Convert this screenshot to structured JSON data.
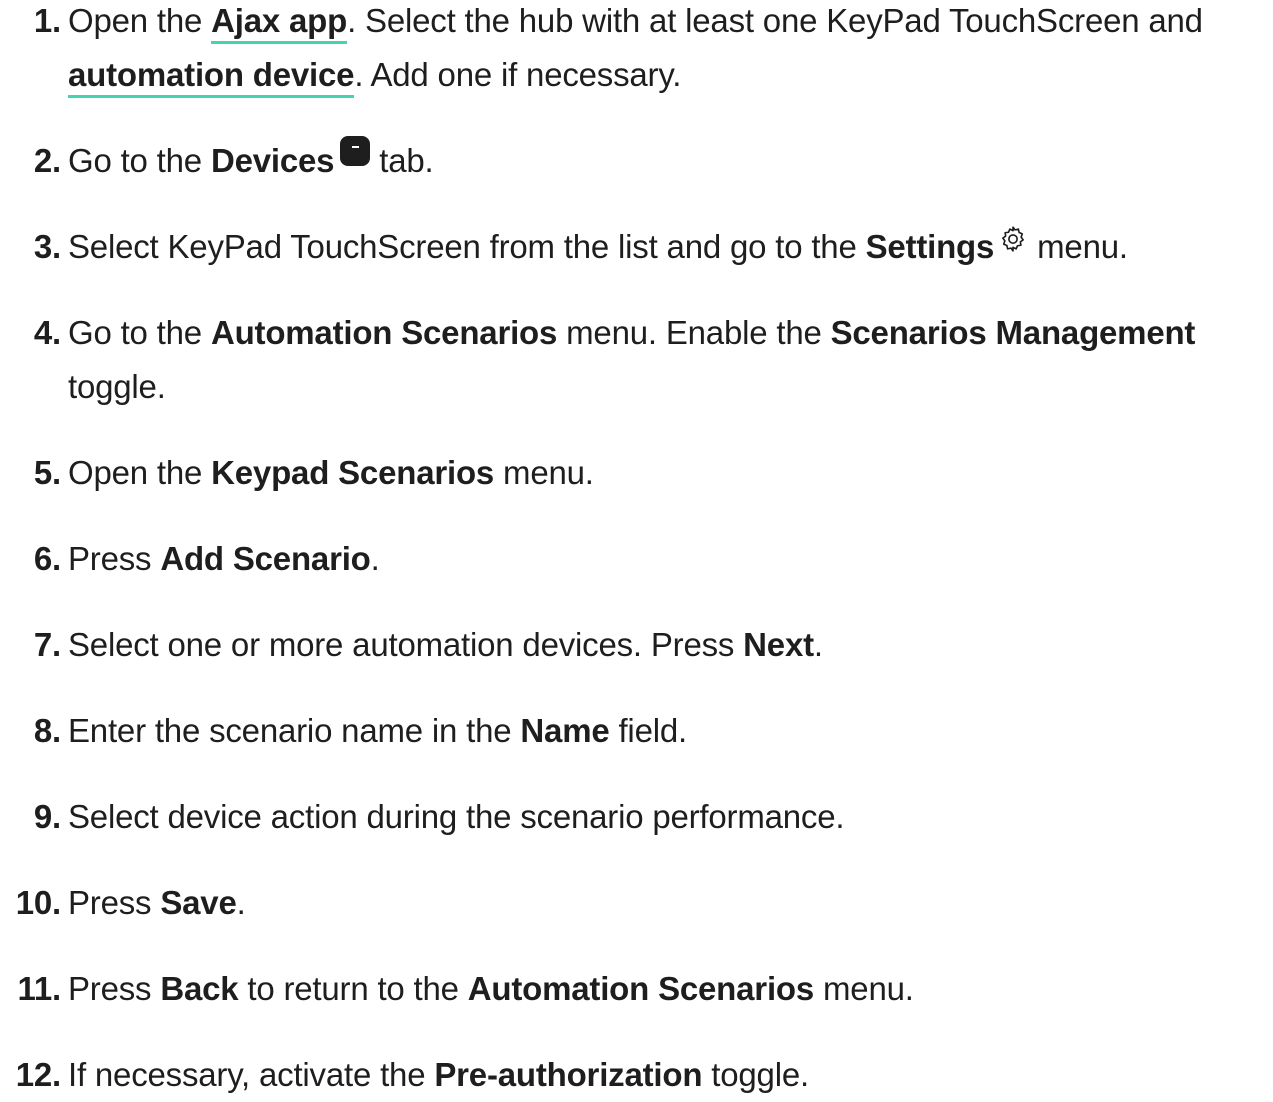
{
  "steps": [
    {
      "num": "1.",
      "t1": "Open the ",
      "link1": "Ajax app",
      "t2": ". Select the hub with at least one KeyPad TouchScreen and ",
      "link2": "automation device",
      "t3": ". Add one if necessary."
    },
    {
      "num": "2.",
      "t1": "Go to the ",
      "b1": "Devices",
      "icon": "devices-tab-icon",
      "t2": " tab."
    },
    {
      "num": "3.",
      "t1": "Select KeyPad TouchScreen from the list and go to the ",
      "b1": "Settings",
      "icon": "gear-icon",
      "t2": " menu."
    },
    {
      "num": "4.",
      "t1": "Go to the ",
      "b1": "Automation Scenarios",
      "t2": " menu. Enable the ",
      "b2": "Scenarios Management",
      "t3": " toggle."
    },
    {
      "num": "5.",
      "t1": "Open the ",
      "b1": "Keypad Scenarios",
      "t2": " menu."
    },
    {
      "num": "6.",
      "t1": "Press ",
      "b1": "Add Scenario",
      "t2": "."
    },
    {
      "num": "7.",
      "t1": "Select one or more automation devices. Press ",
      "b1": "Next",
      "t2": "."
    },
    {
      "num": "8.",
      "t1": "Enter the scenario name in the ",
      "b1": "Name",
      "t2": " field."
    },
    {
      "num": "9.",
      "t1": "Select device action during the scenario performance."
    },
    {
      "num": "10.",
      "t1": "Press ",
      "b1": "Save",
      "t2": "."
    },
    {
      "num": "11.",
      "t1": "Press ",
      "b1": "Back",
      "t2": " to return to the ",
      "b2": "Automation Scenarios",
      "t3": " menu."
    },
    {
      "num": "12.",
      "t1": "If necessary, activate the ",
      "b1": "Pre-authorization",
      "t2": " toggle."
    }
  ],
  "colors": {
    "text": "#1e1e1e",
    "link_underline": "#3fd6b0"
  }
}
